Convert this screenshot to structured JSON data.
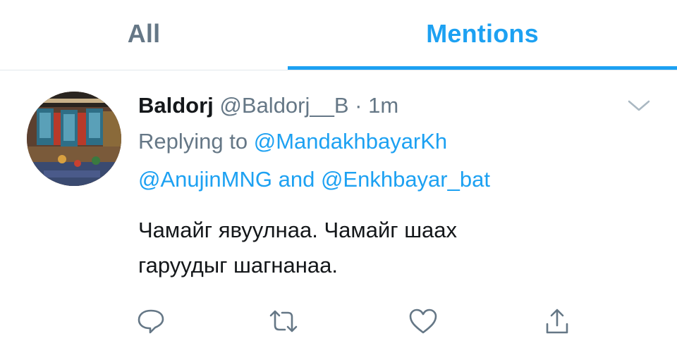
{
  "tabs": [
    {
      "label": "All",
      "active": false
    },
    {
      "label": "Mentions",
      "active": true
    }
  ],
  "colors": {
    "accent": "#1da1f2",
    "muted": "#657786",
    "text": "#14171a",
    "divider": "#e1e8ed"
  },
  "tweet": {
    "display_name": "Baldorj",
    "handle": "@Baldorj__B",
    "separator": "·",
    "time": "1m",
    "replying_prefix": "Replying to",
    "reply_user_1": "@MandakhbayarKh",
    "reply_user_2": "@AnujinMNG",
    "reply_conjunction": "and",
    "reply_user_3": "@Enkhbayar_bat",
    "text_line_1": "Чамайг явуулнаа. Чамайг шаах",
    "text_line_2": "гаруудыг шагнанаа."
  },
  "icons": {
    "caret": "chevron-down-icon",
    "reply": "reply-icon",
    "retweet": "retweet-icon",
    "like": "heart-icon",
    "share": "share-icon"
  }
}
